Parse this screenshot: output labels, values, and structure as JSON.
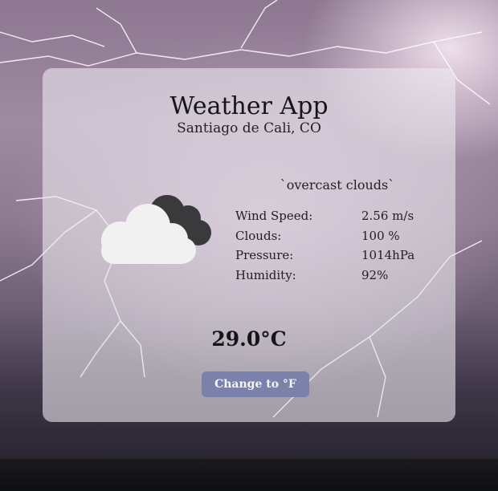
{
  "app": {
    "title": "Weather App",
    "location": "Santiago de Cali, CO"
  },
  "weather": {
    "description": "`overcast clouds`",
    "icon": "overcast-clouds-icon",
    "temperature": "29.0°C",
    "stats": [
      {
        "label": "Wind Speed:",
        "value": "2.56 m/s"
      },
      {
        "label": "Clouds:",
        "value": "100 %"
      },
      {
        "label": "Pressure:",
        "value": "1014hPa"
      },
      {
        "label": "Humidity:",
        "value": "92%"
      }
    ]
  },
  "controls": {
    "toggle_unit_label": "Change to °F"
  },
  "colors": {
    "button": "#7c81ac",
    "card": "rgba(236,234,240,0.6)"
  }
}
